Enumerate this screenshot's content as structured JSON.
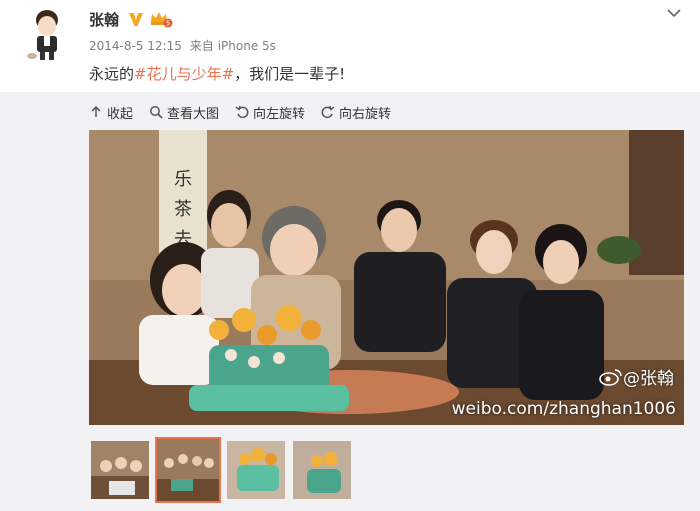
{
  "post": {
    "author": "张翰",
    "timestamp": "2014-8-5 12:15",
    "source_prefix": "来自",
    "source": "iPhone 5s",
    "text_before": "永远的",
    "topic": "#花儿与少年#",
    "text_after": "，我们是一辈子!"
  },
  "badges": {
    "verified": "verified-v-icon",
    "vip_level": "5"
  },
  "toolbar": {
    "collapse_label": "收起",
    "view_large_label": "查看大图",
    "rotate_left_label": "向左旋转",
    "rotate_right_label": "向右旋转"
  },
  "watermark": {
    "handle": "@张翰",
    "url": "weibo.com/zhanghan1006"
  },
  "thumbnails": {
    "count": 4,
    "active_index": 1
  },
  "colors": {
    "accent": "#eb7350",
    "verified": "#f5a623",
    "meta": "#808080",
    "media_bg": "#f2f2f5"
  }
}
